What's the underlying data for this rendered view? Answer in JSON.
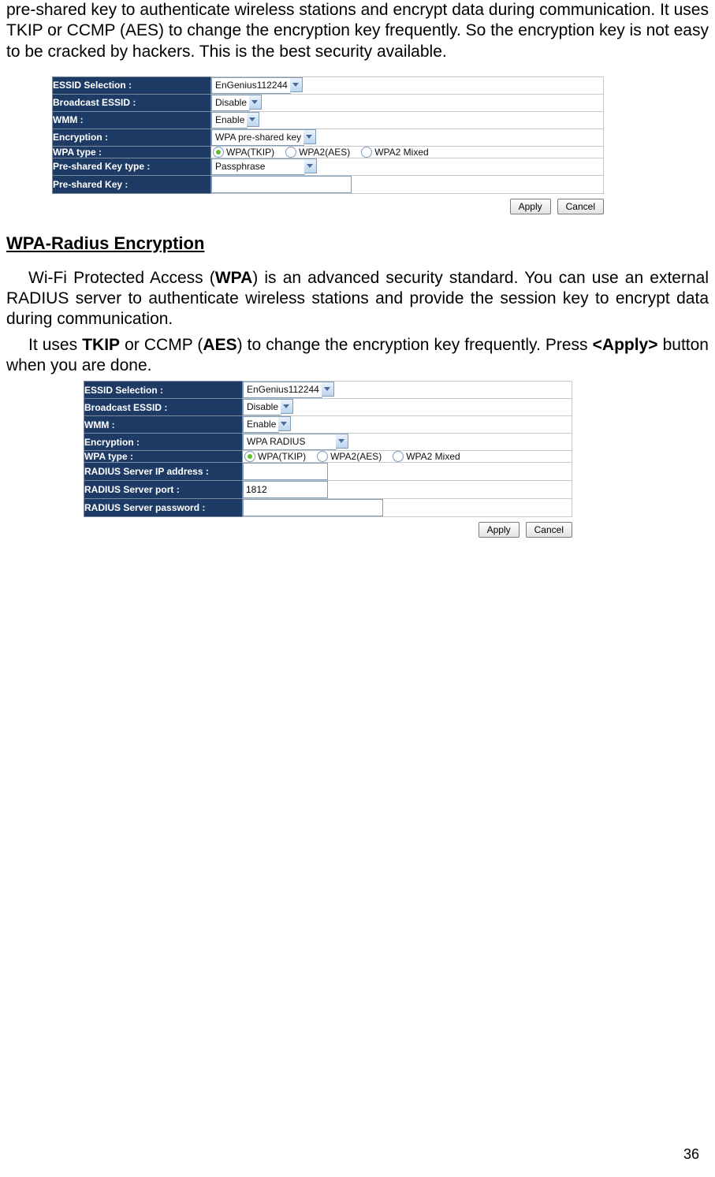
{
  "intro_text": "pre-shared key to authenticate wireless stations and encrypt data during communication. It uses TKIP or CCMP (AES) to change the encryption key frequently. So the encryption key is not easy to be cracked by hackers. This is the best security available.",
  "section1": {
    "rows": {
      "essid_label": "ESSID Selection :",
      "essid_value": "EnGenius112244",
      "bcast_label": "Broadcast ESSID :",
      "bcast_value": "Disable",
      "wmm_label": "WMM :",
      "wmm_value": "Enable",
      "enc_label": "Encryption :",
      "enc_value": "WPA pre-shared key",
      "wpatype_label": "WPA type :",
      "wpa_opt1": "WPA(TKIP)",
      "wpa_opt2": "WPA2(AES)",
      "wpa_opt3": "WPA2 Mixed",
      "pskt_label": "Pre-shared Key type :",
      "pskt_value": "Passphrase",
      "psk_label": "Pre-shared Key :"
    },
    "buttons": {
      "apply": "Apply",
      "cancel": "Cancel"
    }
  },
  "heading_radius": "WPA-Radius Encryption",
  "radius_para1_a": "Wi-Fi Protected Access (",
  "radius_para1_b": "WPA",
  "radius_para1_c": ") is an advanced security standard. You can use an external RADIUS server to authenticate wireless stations and provide the session key to encrypt data during communication.",
  "radius_para2_a": "It uses ",
  "radius_para2_b": "TKIP",
  "radius_para2_c": " or CCMP (",
  "radius_para2_d": "AES",
  "radius_para2_e": ") to change the encryption key frequently. Press ",
  "radius_para2_f": "<Apply>",
  "radius_para2_g": " button when you are done.",
  "section2": {
    "rows": {
      "essid_label": "ESSID Selection :",
      "essid_value": "EnGenius112244",
      "bcast_label": "Broadcast ESSID :",
      "bcast_value": "Disable",
      "wmm_label": "WMM :",
      "wmm_value": "Enable",
      "enc_label": "Encryption :",
      "enc_value": "WPA RADIUS",
      "wpatype_label": "WPA type :",
      "wpa_opt1": "WPA(TKIP)",
      "wpa_opt2": "WPA2(AES)",
      "wpa_opt3": "WPA2 Mixed",
      "rip_label": "RADIUS Server IP address :",
      "rport_label": "RADIUS Server port :",
      "rport_value": "1812",
      "rpass_label": "RADIUS Server password :"
    },
    "buttons": {
      "apply": "Apply",
      "cancel": "Cancel"
    }
  },
  "page_number": "36"
}
